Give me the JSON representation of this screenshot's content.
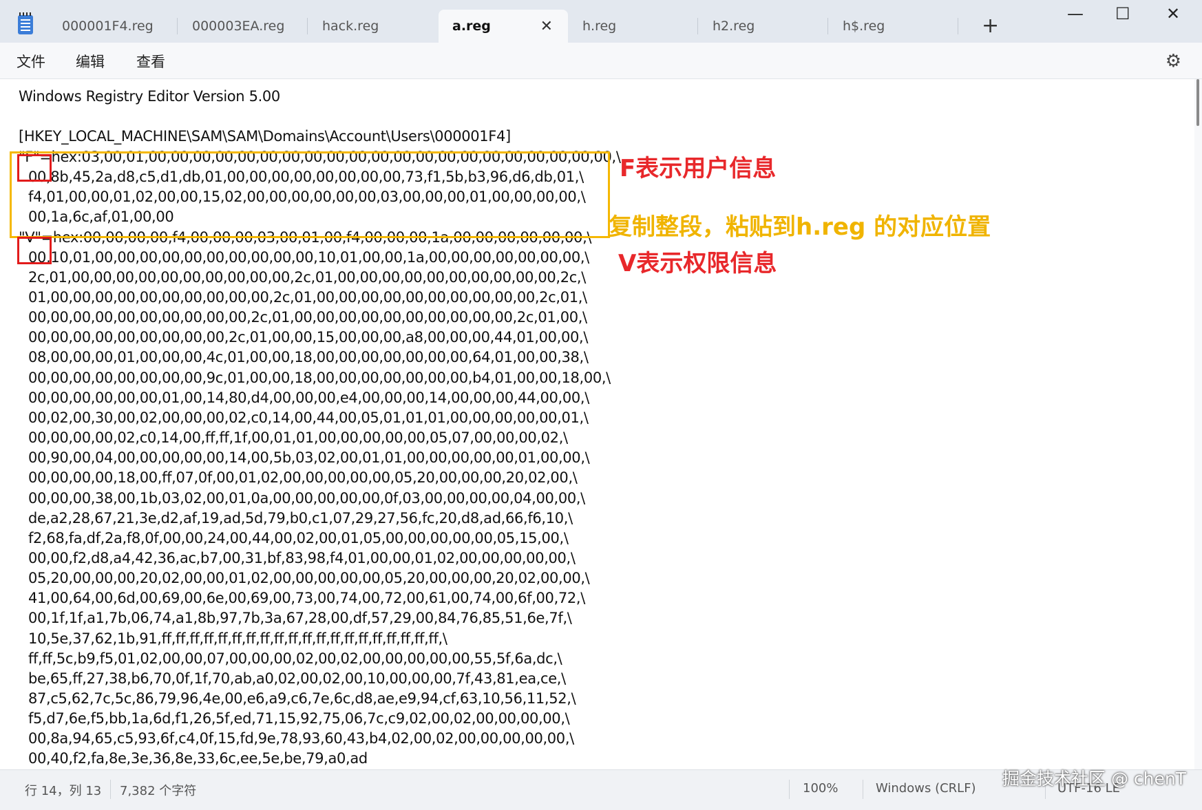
{
  "tabs": [
    {
      "label": "000001F4.reg"
    },
    {
      "label": "000003EA.reg"
    },
    {
      "label": "hack.reg"
    },
    {
      "label": "a.reg",
      "active": true
    },
    {
      "label": "h.reg"
    },
    {
      "label": "h2.reg"
    },
    {
      "label": "h$.reg"
    }
  ],
  "window_controls": {
    "new_tab": "+",
    "minimize": "—",
    "maximize": "☐",
    "close": "✕",
    "tab_close": "✕"
  },
  "menu": {
    "file": "文件",
    "edit": "编辑",
    "view": "查看",
    "settings_icon": "⚙"
  },
  "editor": {
    "lines": [
      "Windows Registry Editor Version 5.00",
      "[HKEY_LOCAL_MACHINE\\SAM\\SAM\\Domains\\Account\\Users\\000001F4]",
      "\"F\"=hex:03,00,01,00,00,00,00,00,00,00,00,00,00,00,00,00,00,00,00,00,00,00,00,00,\\",
      "00,8b,45,2a,d8,c5,d1,db,01,00,00,00,00,00,00,00,00,73,f1,5b,b3,96,d6,db,01,\\",
      "f4,01,00,00,01,02,00,00,15,02,00,00,00,00,00,00,03,00,00,00,01,00,00,00,00,\\",
      "00,1a,6c,af,01,00,00",
      "\"V\"=hex:00,00,00,00,f4,00,00,00,03,00,01,00,f4,00,00,00,1a,00,00,00,00,00,00,\\",
      "00,10,01,00,00,00,00,00,00,00,00,00,00,10,01,00,00,1a,00,00,00,00,00,00,00,\\",
      "2c,01,00,00,00,00,00,00,00,00,00,00,2c,01,00,00,00,00,00,00,00,00,00,00,2c,\\",
      "01,00,00,00,00,00,00,00,00,00,00,2c,01,00,00,00,00,00,00,00,00,00,00,2c,01,\\",
      "00,00,00,00,00,00,00,00,00,00,2c,01,00,00,00,00,00,00,00,00,00,00,2c,01,00,\\",
      "00,00,00,00,00,00,00,00,00,2c,01,00,00,15,00,00,00,a8,00,00,00,44,01,00,00,\\",
      "08,00,00,00,01,00,00,00,4c,01,00,00,18,00,00,00,00,00,00,00,64,01,00,00,38,\\",
      "00,00,00,00,00,00,00,00,9c,01,00,00,18,00,00,00,00,00,00,00,b4,01,00,00,18,00,\\",
      "00,00,00,00,00,00,01,00,14,80,d4,00,00,00,e4,00,00,00,14,00,00,00,44,00,00,\\",
      "00,02,00,30,00,02,00,00,00,02,c0,14,00,44,00,05,01,01,01,00,00,00,00,00,01,\\",
      "00,00,00,00,02,c0,14,00,ff,ff,1f,00,01,01,00,00,00,00,00,05,07,00,00,00,02,\\",
      "00,90,00,04,00,00,00,00,00,14,00,5b,03,02,00,01,01,00,00,00,00,00,01,00,00,\\",
      "00,00,00,00,18,00,ff,07,0f,00,01,02,00,00,00,00,00,05,20,00,00,00,20,02,00,\\",
      "00,00,00,38,00,1b,03,02,00,01,0a,00,00,00,00,00,0f,03,00,00,00,00,04,00,00,\\",
      "de,a2,28,67,21,3e,d2,af,19,ad,5d,79,b0,c1,07,29,27,56,fc,20,d8,ad,66,f6,10,\\",
      "f2,68,fa,df,2a,f8,0f,00,00,24,00,44,00,02,00,01,05,00,00,00,00,00,05,15,00,\\",
      "00,00,f2,d8,a4,42,36,ac,b7,00,31,bf,83,98,f4,01,00,00,01,02,00,00,00,00,00,\\",
      "05,20,00,00,00,20,02,00,00,01,02,00,00,00,00,00,05,20,00,00,00,20,02,00,00,\\",
      "41,00,64,00,6d,00,69,00,6e,00,69,00,73,00,74,00,72,00,61,00,74,00,6f,00,72,\\",
      "00,1f,1f,a1,7b,06,74,a1,8b,97,7b,3a,67,28,00,df,57,29,00,84,76,85,51,6e,7f,\\",
      "10,5e,37,62,1b,91,ff,ff,ff,ff,ff,ff,ff,ff,ff,ff,ff,ff,ff,ff,ff,ff,ff,ff,ff,ff,\\",
      "ff,ff,5c,b9,f5,01,02,00,00,07,00,00,00,02,00,02,00,00,00,00,00,55,5f,6a,dc,\\",
      "be,65,ff,27,38,b6,70,0f,1f,70,ab,a0,02,00,02,00,10,00,00,00,7f,43,81,ea,ce,\\",
      "87,c5,62,7c,5c,86,79,96,4e,00,e6,a9,c6,7e,6c,d8,ae,e9,94,cf,63,10,56,11,52,\\",
      "f5,d7,6e,f5,bb,1a,6d,f1,26,5f,ed,71,15,92,75,06,7c,c9,02,00,02,00,00,00,00,\\",
      "00,8a,94,65,c5,93,6f,c4,0f,15,fd,9e,78,93,60,43,b4,02,00,02,00,00,00,00,00,\\",
      "00,40,f2,fa,8e,3e,36,8e,33,6c,ee,5e,be,79,a0,ad"
    ]
  },
  "annotations": {
    "f_note": "F表示用户信息",
    "copy_note": "复制整段，粘贴到h.reg 的对应位置",
    "v_note": "V表示权限信息",
    "color_red": "#e8282b",
    "color_yellow": "#f0b400"
  },
  "status": {
    "position": "行 14，列 13",
    "chars": "7,382 个字符",
    "zoom": "100%",
    "line_ending": "Windows (CRLF)",
    "encoding": "UTF-16 LE"
  },
  "watermark": "掘金技术社区 @ chenT"
}
